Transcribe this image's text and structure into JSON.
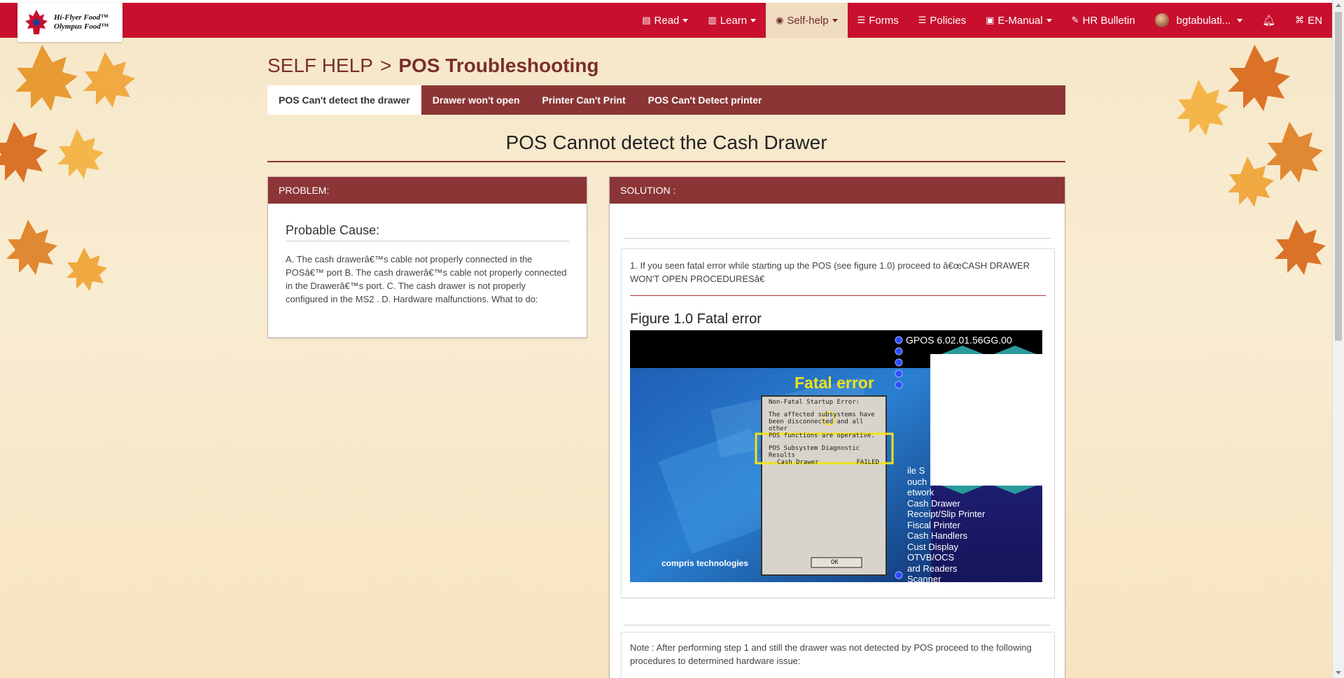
{
  "brand": {
    "logo_line1": "Hi-Flyer Food™",
    "logo_line2": "Olympus Food™"
  },
  "nav": {
    "items": [
      {
        "label": "Read",
        "icon": "book-icon",
        "caret": true
      },
      {
        "label": "Learn",
        "icon": "book-open-icon",
        "caret": true
      },
      {
        "label": "Self-help",
        "icon": "life-ring-icon",
        "caret": true,
        "active": true
      },
      {
        "label": "Forms",
        "icon": "list-icon",
        "caret": false
      },
      {
        "label": "Policies",
        "icon": "list-icon",
        "caret": false
      },
      {
        "label": "E-Manual",
        "icon": "manual-icon",
        "caret": true
      },
      {
        "label": "HR Bulletin",
        "icon": "pin-icon",
        "caret": false
      }
    ],
    "user": "bgtabulati...",
    "language": "EN"
  },
  "breadcrumb": {
    "parent": "SELF HELP",
    "separator": ">",
    "current": "POS Troubleshooting"
  },
  "tabs": [
    {
      "label": "POS Can't detect the drawer",
      "active": true
    },
    {
      "label": "Drawer won't open",
      "active": false
    },
    {
      "label": "Printer Can't Print",
      "active": false
    },
    {
      "label": "POS Can't Detect printer",
      "active": false
    }
  ],
  "page_heading": "POS Cannot detect the Cash Drawer",
  "problem": {
    "header": "PROBLEM:",
    "title": "Probable Cause:",
    "body": "A. The cash drawerâ€™s cable not properly connected in the POSâ€™ port B. The cash drawerâ€™s cable not properly connected in the Drawerâ€™s port. C. The cash drawer is not properly configured in the MS2 . D. Hardware malfunctions. What to do:"
  },
  "solution": {
    "header": "SOLUTION :",
    "step1": "1. If you seen fatal error while starting up the POS (see figure 1.0) proceed to â€œCASH DRAWER WON'T OPEN PROCEDURESâ€",
    "figure_title": "Figure 1.0 Fatal error",
    "figure": {
      "version": "GPOS 6.02.01.56GG.00",
      "banner": "Fatal error",
      "dialog_title": "Non-Fatal Startup Error:",
      "dialog_line1": "The affected subsystems have",
      "dialog_line2": "been disconnected and all other",
      "dialog_line3": "POS functions are operative.",
      "diag_title": "POS Subsystem Diagnostic Results",
      "diag_item": "Cash Drawer",
      "diag_status": "FAILED",
      "ok_label": "OK",
      "brand": "compris technologies",
      "menu": [
        "ile S",
        "ouch",
        "etwork",
        "Cash Drawer",
        "Receipt/Slip Printer",
        "Fiscal Printer",
        "Cash Handlers",
        "Cust Display",
        "OTVB/OCS",
        "ard Readers",
        "Scanner"
      ]
    },
    "note": "Note : After performing step 1 and still the drawer was not detected by POS proceed to the following procedures to determined hardware issue:"
  }
}
